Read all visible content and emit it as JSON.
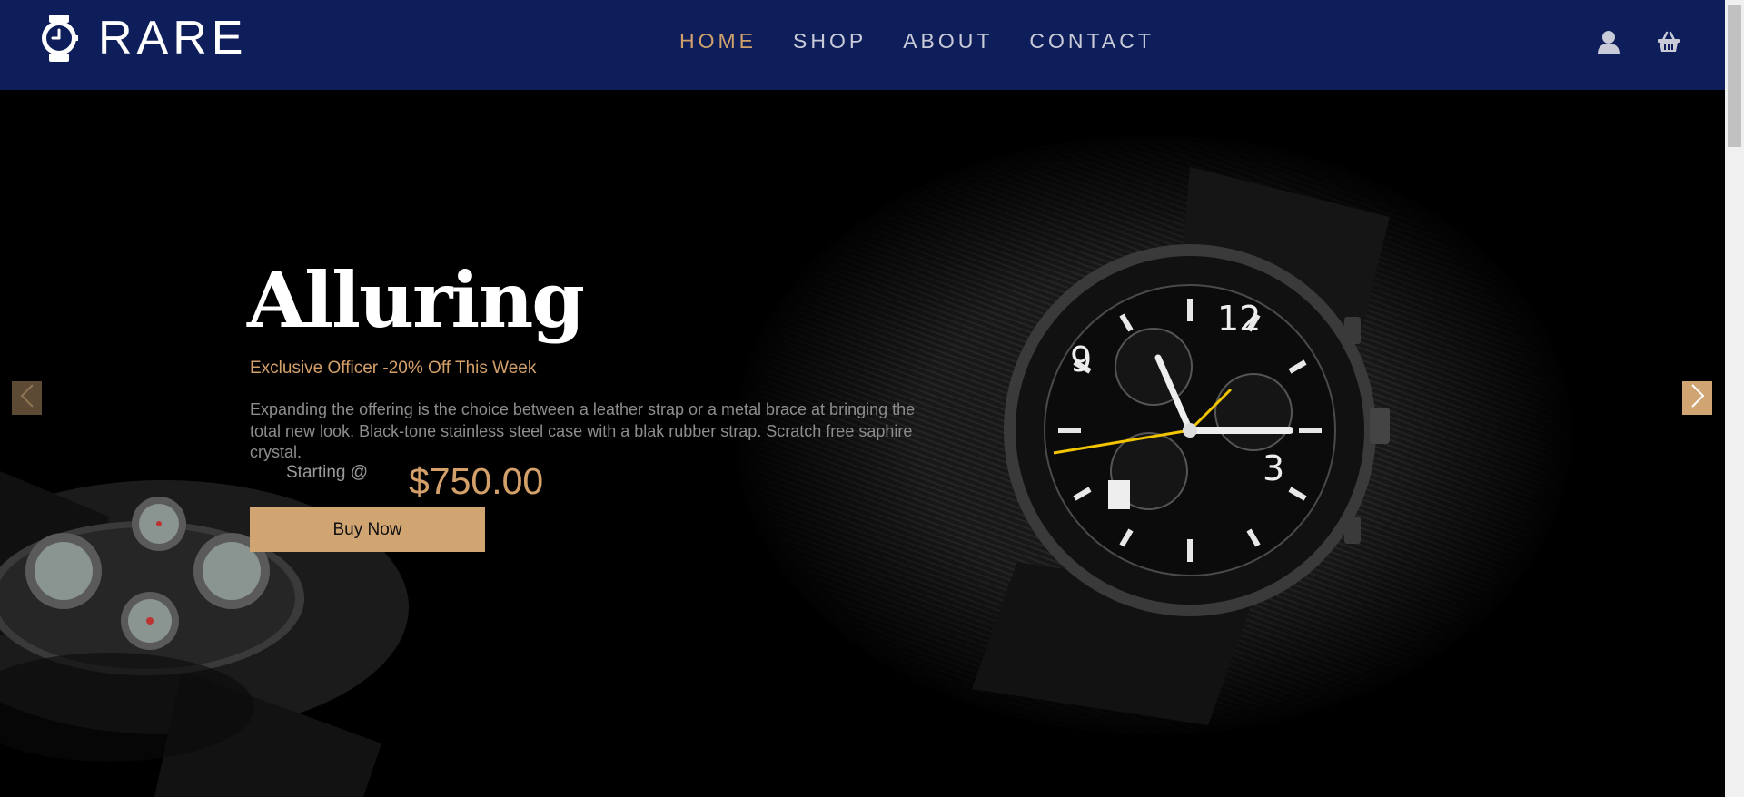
{
  "brand": {
    "name": "RARE",
    "icon": "watch-icon"
  },
  "nav": {
    "items": [
      {
        "label": "HOME",
        "active": true
      },
      {
        "label": "SHOP",
        "active": false
      },
      {
        "label": "ABOUT",
        "active": false
      },
      {
        "label": "CONTACT",
        "active": false
      }
    ]
  },
  "header_icons": {
    "account": "user-icon",
    "cart": "basket-icon"
  },
  "hero": {
    "title": "Alluring",
    "tagline": "Exclusive Officer -20% Off This Week",
    "description": "Expanding the offering is the choice between a leather strap or a metal brace at bringing the total new look. Black-tone stainless steel case with a blak rubber strap. Scratch free saphire crystal.",
    "starting_label": "Starting @",
    "price": "$750.00",
    "cta_label": "Buy Now"
  },
  "carousel": {
    "prev_icon": "chevron-left-icon",
    "next_icon": "chevron-right-icon"
  },
  "colors": {
    "header_bg": "#0e1e5b",
    "accent": "#d1a572",
    "hero_bg": "#000000"
  }
}
